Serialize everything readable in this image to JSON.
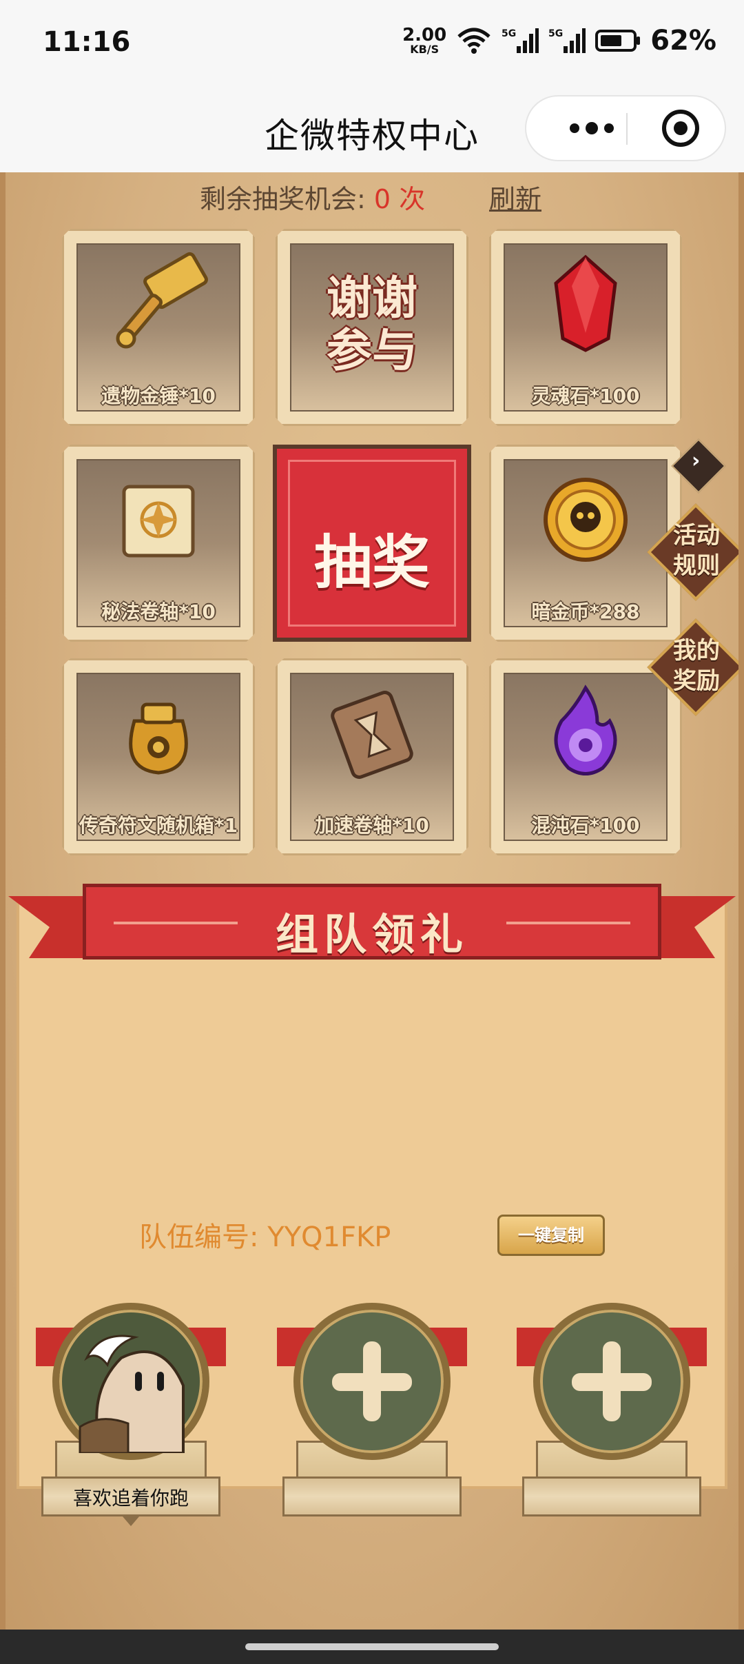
{
  "status_bar": {
    "time": "11:16",
    "speed_value": "2.00",
    "speed_unit": "KB/S",
    "battery_percent": "62%"
  },
  "nav": {
    "title": "企微特权中心"
  },
  "lottery": {
    "remaining_label": "剩余抽奖机会: ",
    "remaining_count": "0 次",
    "refresh_label": "刷新",
    "draw_button": "抽奖",
    "prizes": [
      {
        "label": "遗物金锤*10",
        "icon": "hammer-icon"
      },
      {
        "thanks_line1": "谢谢",
        "thanks_line2": "参与"
      },
      {
        "label": "灵魂石*100",
        "icon": "red-gem-icon"
      },
      {
        "label": "秘法卷轴*10",
        "icon": "scroll-icon"
      },
      {
        "label": "暗金币*288",
        "icon": "skull-coin-icon"
      },
      {
        "label": "传奇符文随机箱*1",
        "icon": "rune-bag-icon"
      },
      {
        "label": "加速卷轴*10",
        "icon": "hourglass-scroll-icon"
      },
      {
        "label": "混沌石*100",
        "icon": "purple-flame-icon"
      }
    ]
  },
  "side_tabs": {
    "rules_line1": "活动",
    "rules_line2": "规则",
    "rewards_line1": "我的",
    "rewards_line2": "奖励"
  },
  "team": {
    "banner_title": "组队领礼",
    "team_id_label": "队伍编号: YYQ1FKP",
    "copy_button": "一键复制",
    "members": [
      {
        "name": "喜欢追着你跑"
      },
      {
        "name": ""
      },
      {
        "name": ""
      }
    ]
  },
  "colors": {
    "accent_red": "#d8313a",
    "highlight_orange": "#e08a30",
    "parchment": "#d6b182"
  }
}
